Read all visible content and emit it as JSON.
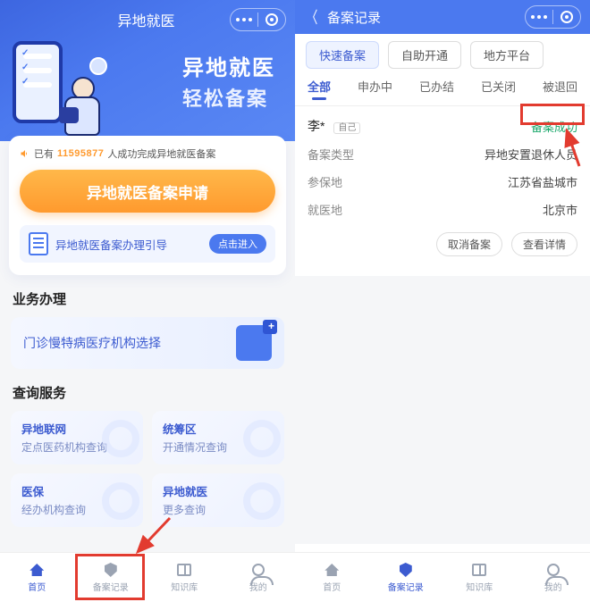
{
  "left": {
    "title": "异地就医",
    "hero_line1": "异地就医",
    "hero_line2": "轻松备案",
    "success_prefix": "已有",
    "success_count": "11595877",
    "success_suffix": "人成功完成异地就医备案",
    "apply_btn": "异地就医备案申请",
    "guide_text": "异地就医备案办理引导",
    "guide_chip": "点击进入",
    "biz_title": "业务办理",
    "biz_item": "门诊慢特病医疗机构选择",
    "query_title": "查询服务",
    "queries": [
      {
        "l1": "异地联网",
        "l2": "定点医药机构查询"
      },
      {
        "l1": "统筹区",
        "l2": "开通情况查询"
      },
      {
        "l1": "医保",
        "l2": "经办机构查询"
      },
      {
        "l1": "异地就医",
        "l2": "更多查询"
      }
    ],
    "tabs": [
      "首页",
      "备案记录",
      "知识库",
      "我的"
    ]
  },
  "right": {
    "title": "备案记录",
    "filters": [
      "快速备案",
      "自助开通",
      "地方平台"
    ],
    "tabs": [
      "全部",
      "申办中",
      "已办结",
      "已关闭",
      "被退回"
    ],
    "name": "李*",
    "self_tag": "自己",
    "status": "备案成功",
    "rows": [
      {
        "k": "备案类型",
        "v": "异地安置退休人员"
      },
      {
        "k": "参保地",
        "v": "江苏省盐城市"
      },
      {
        "k": "就医地",
        "v": "北京市"
      }
    ],
    "actions": [
      "取消备案",
      "查看详情"
    ],
    "tabs_bottom": [
      "首页",
      "备案记录",
      "知识库",
      "我的"
    ]
  }
}
